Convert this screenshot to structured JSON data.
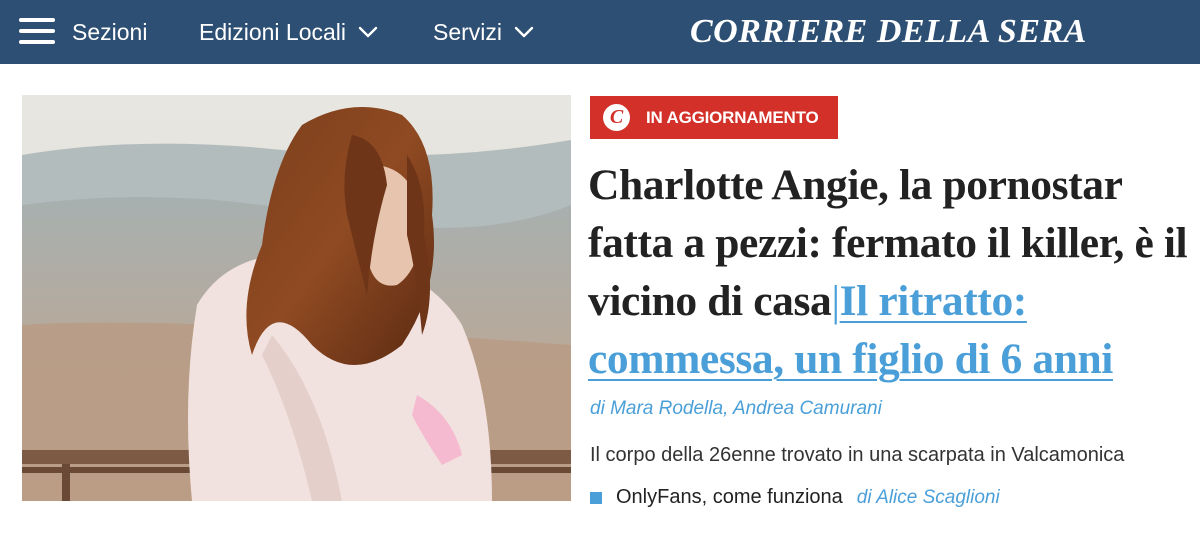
{
  "header": {
    "menu_label": "Sezioni",
    "local_editions_label": "Edizioni Locali",
    "services_label": "Servizi",
    "brand": "CORRIERE DELLA SERA",
    "menu_icon": "hamburger-icon",
    "dropdown_icon": "chevron-down-icon",
    "background_color": "#2d4f73"
  },
  "article": {
    "badge_logo": "C",
    "badge_label": "IN AGGIORNAMENTO",
    "badge_color": "#d3302a",
    "headline": "Charlotte Angie, la pornostar fatta a pezzi: fermato il killer, è il vicino di casa",
    "separator": "|",
    "linked_headline": "Il ritratto: commessa, un figlio di 6 anni",
    "authors": "di Mara Rodella, Andrea Camurani",
    "summary": "Il corpo della 26enne trovato in una scarpata in Valcamonica",
    "related": {
      "title": "OnlyFans, come funziona",
      "author": "di Alice Scaglioni"
    },
    "link_color": "#4a9fd9"
  }
}
